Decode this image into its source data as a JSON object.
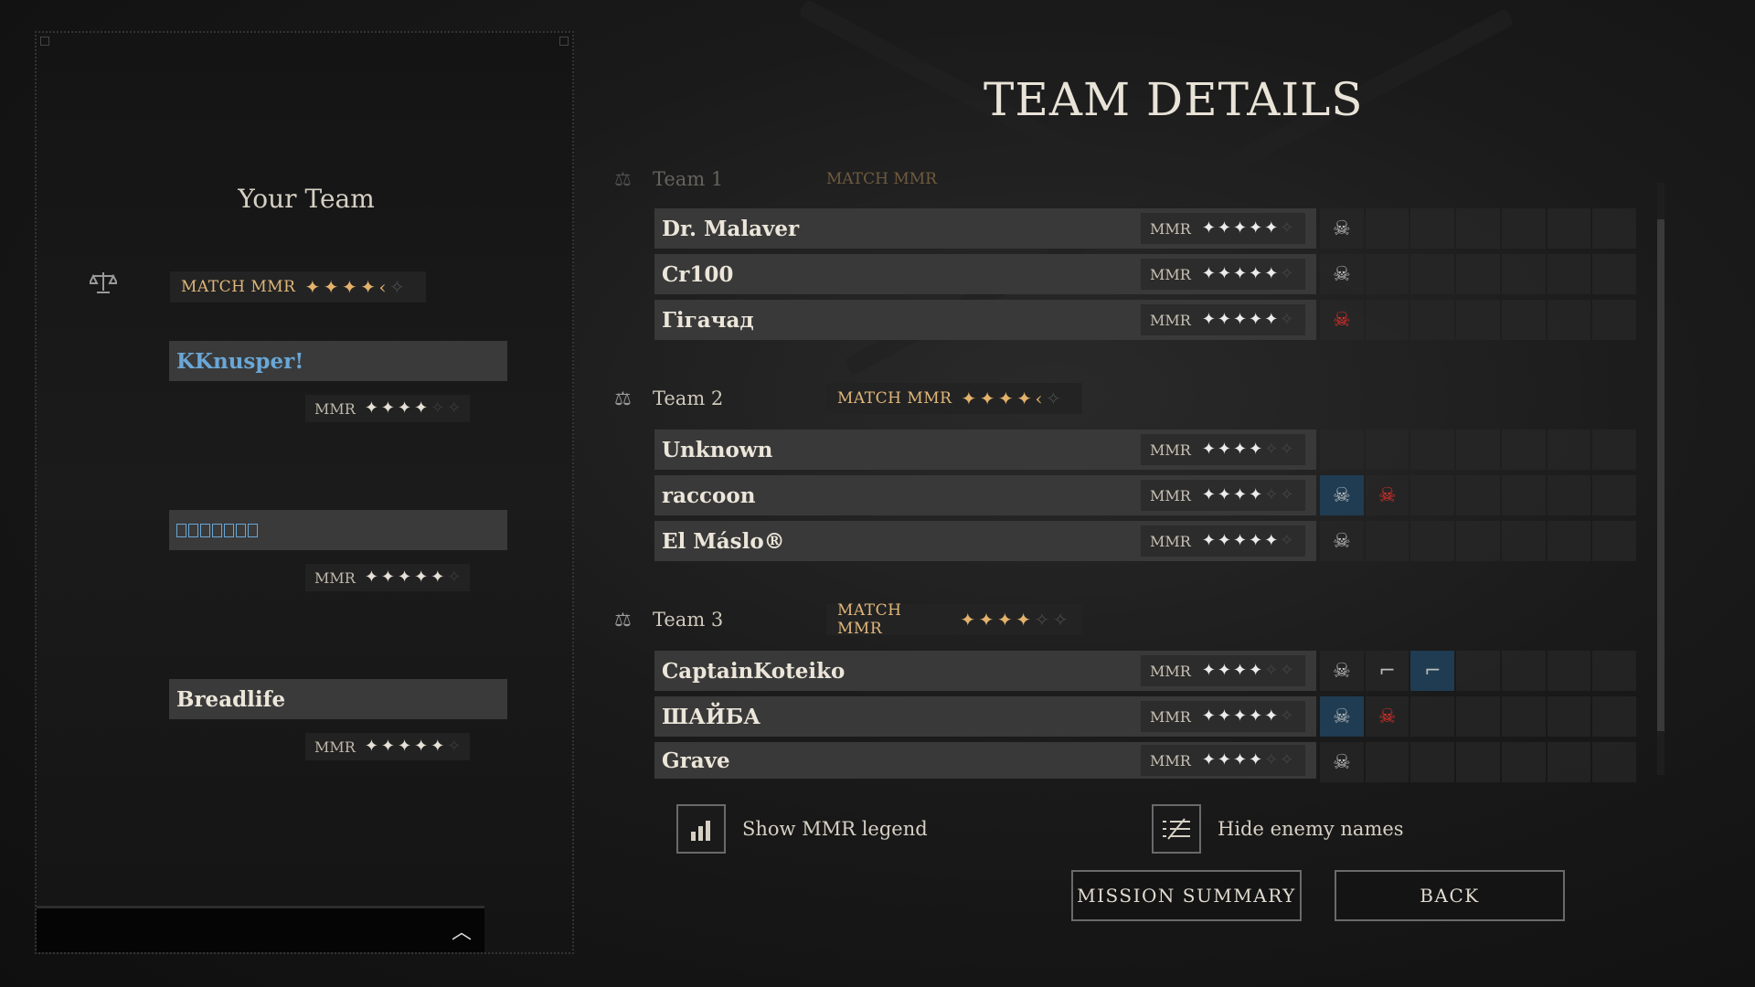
{
  "left_panel": {
    "title": "Your Team",
    "match_mmr": {
      "label": "MATCH MMR",
      "stars": [
        "on",
        "on",
        "on",
        "on",
        "half",
        "off"
      ]
    },
    "players": [
      {
        "name": "KKnusper!",
        "mmr_label": "MMR",
        "stars": [
          "on",
          "on",
          "on",
          "on",
          "off",
          "off"
        ]
      },
      {
        "name": "",
        "mmr_label": "MMR",
        "stars": [
          "on",
          "on",
          "on",
          "on",
          "on",
          "off"
        ]
      },
      {
        "name": "Breadlife",
        "mmr_label": "MMR",
        "stars": [
          "on",
          "on",
          "on",
          "on",
          "on",
          "off"
        ]
      }
    ]
  },
  "title": "TEAM DETAILS",
  "teams": [
    {
      "name": "Team 1",
      "match_mmr_label": "MATCH MMR",
      "players": [
        {
          "name": "Dr. Malaver",
          "mmr_label": "MMR"
        },
        {
          "name": "Cr100",
          "mmr_label": "MMR"
        },
        {
          "name": "Гігачад",
          "mmr_label": "MMR"
        }
      ]
    },
    {
      "name": "Team 2",
      "match_mmr_label": "MATCH MMR",
      "players": [
        {
          "name": "Unknown",
          "mmr_label": "MMR"
        },
        {
          "name": "raccoon",
          "mmr_label": "MMR"
        },
        {
          "name": "El Máslo®",
          "mmr_label": "MMR"
        }
      ]
    },
    {
      "name": "Team 3",
      "match_mmr_label": "MATCH MMR",
      "players": [
        {
          "name": "CaptainKoteiko",
          "mmr_label": "MMR"
        },
        {
          "name": "ШАЙБА",
          "mmr_label": "MMR"
        },
        {
          "name": "Grave",
          "mmr_label": "MMR"
        }
      ]
    }
  ],
  "toggles": {
    "mmr_legend": "Show MMR legend",
    "hide_names": "Hide enemy names"
  },
  "buttons": {
    "mission_summary": "MISSION SUMMARY",
    "back": "BACK"
  },
  "colors": {
    "accent_gold": "#e3b26d",
    "player_highlight": "#6aa7d6",
    "kill_red": "#e0302a",
    "active_cell": "#1f3c52"
  }
}
